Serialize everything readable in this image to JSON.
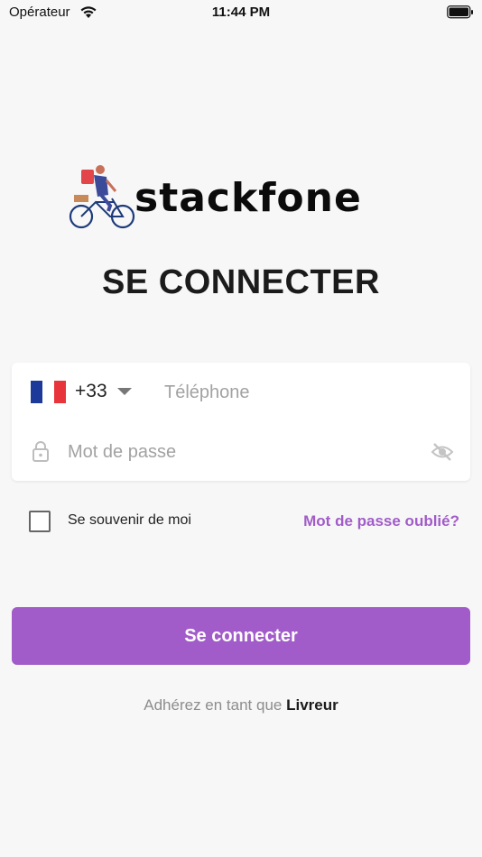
{
  "status_bar": {
    "carrier": "Opérateur",
    "time": "11:44 PM"
  },
  "logo": {
    "text": "stackfone"
  },
  "page_title": "SE CONNECTER",
  "form": {
    "country_flag": "france-flag",
    "flag_colors": [
      "#1d3a9a",
      "#ffffff",
      "#e8353b"
    ],
    "dial_code": "+33",
    "phone_placeholder": "Téléphone",
    "password_placeholder": "Mot de passe"
  },
  "remember_label": "Se souvenir de moi",
  "forgot_password_label": "Mot de passe oublié?",
  "login_button_label": "Se connecter",
  "join": {
    "prefix": "Adhérez en tant que",
    "link_label": "Livreur"
  },
  "colors": {
    "accent": "#a25cc9",
    "background": "#f7f7f7"
  }
}
